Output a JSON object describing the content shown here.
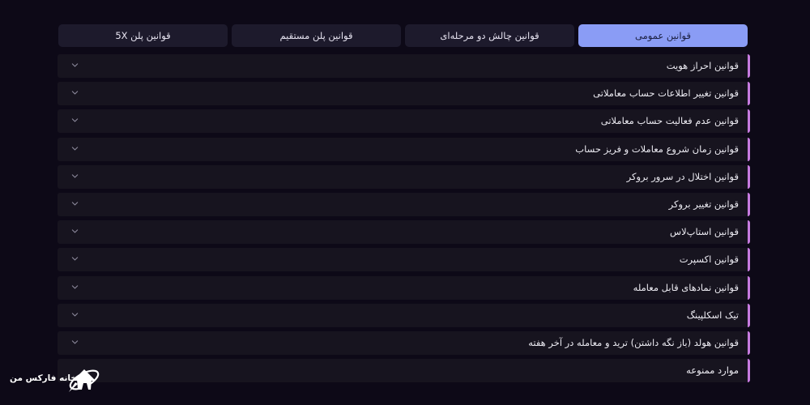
{
  "tabs": [
    {
      "label": "قوانین عمومی",
      "active": true
    },
    {
      "label": "قوانین چالش دو مرحله‌ای",
      "active": false
    },
    {
      "label": "قوانین پلن مستقیم",
      "active": false
    },
    {
      "label": "قوانین پلن 5X",
      "active": false
    }
  ],
  "accordion": {
    "items": [
      {
        "label": "قوانین احراز هویت"
      },
      {
        "label": "قوانین تغییر اطلاعات حساب معاملاتی"
      },
      {
        "label": "قوانین عدم فعالیت حساب معاملاتی"
      },
      {
        "label": "قوانین زمان شروع معاملات و فریز حساب"
      },
      {
        "label": "قوانین اختلال در سرور بروکر"
      },
      {
        "label": "قوانین تغییر بروکر"
      },
      {
        "label": "قوانین استاپ‌لاس"
      },
      {
        "label": "قوانین اکسپرت"
      },
      {
        "label": "قوانین نمادهای قابل معامله"
      },
      {
        "label": "تیک اسکلپینگ"
      },
      {
        "label": "قوانین هولد (باز نگه داشتن) ترید و معامله در آخر هفته"
      },
      {
        "label": "موارد ممنوعه"
      }
    ]
  },
  "logo": {
    "text": "خانه فارکس من",
    "icon": "house-rocket-icon"
  },
  "colors": {
    "background": "#0d0917",
    "tab_active": "#8a9cf5",
    "tab_inactive": "#1d1a2c",
    "row_background": "#17141f",
    "row_accent": "#c77be0"
  }
}
